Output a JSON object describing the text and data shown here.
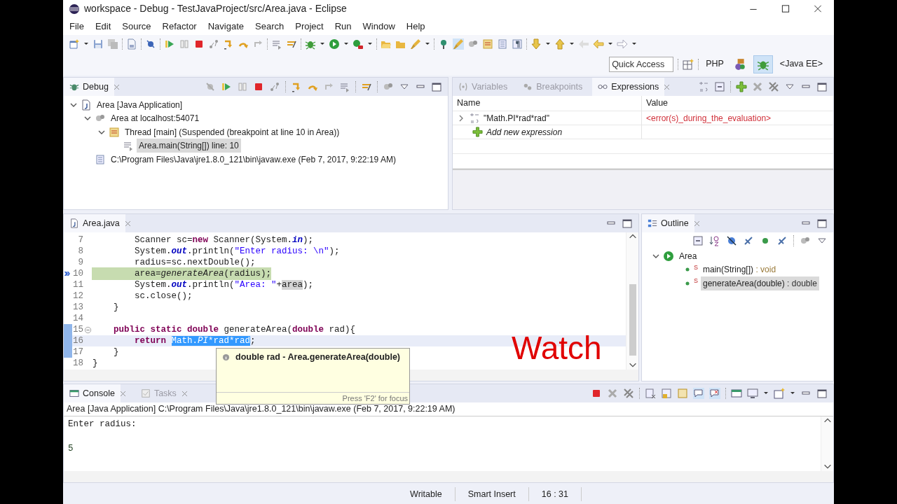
{
  "window": {
    "title": "workspace - Debug - TestJavaProject/src/Area.java - Eclipse"
  },
  "menu": [
    "File",
    "Edit",
    "Source",
    "Refactor",
    "Navigate",
    "Search",
    "Project",
    "Run",
    "Window",
    "Help"
  ],
  "quick_access": {
    "placeholder": "Quick Access"
  },
  "perspectives": [
    {
      "kind": "text",
      "label": "PHP",
      "selected": false
    },
    {
      "kind": "javaee",
      "selected": false
    },
    {
      "kind": "debug",
      "selected": true
    },
    {
      "kind": "text",
      "label": "<Java EE>",
      "selected": false
    }
  ],
  "debug_view": {
    "tab": "Debug",
    "tree": [
      {
        "kind": "launch",
        "label": "Area [Java Application]",
        "expanded": true,
        "selected": false,
        "children": [
          {
            "kind": "target",
            "label": "Area at localhost:54071",
            "expanded": true,
            "selected": false,
            "children": [
              {
                "kind": "thread",
                "label": "Thread [main] (Suspended (breakpoint at line 10 in Area))",
                "expanded": true,
                "selected": false,
                "children": [
                  {
                    "kind": "frame",
                    "label": "Area.main(String[]) line: 10",
                    "selected": true
                  }
                ]
              }
            ]
          },
          {
            "kind": "process",
            "label": "C:\\Program Files\\Java\\jre1.8.0_121\\bin\\javaw.exe (Feb 7, 2017, 9:22:19 AM)",
            "selected": false
          }
        ]
      }
    ]
  },
  "expressions_view": {
    "tabs": [
      {
        "label": "Variables",
        "selected": false
      },
      {
        "label": "Breakpoints",
        "selected": false
      },
      {
        "label": "Expressions",
        "selected": true
      }
    ],
    "columns": [
      "Name",
      "Value"
    ],
    "rows": [
      {
        "name": "\"Math.PI*rad*rad\"",
        "value": "<error(s)_during_the_evaluation>",
        "expanded": false,
        "error": true
      }
    ],
    "add_row": "Add new expression"
  },
  "editor": {
    "tab": "Area.java",
    "lines": [
      {
        "number": "7",
        "segments": [
          {
            "text": "        Scanner sc=",
            "kind": "plain"
          },
          {
            "text": "new",
            "kind": "keyword"
          },
          {
            "text": " Scanner(System.",
            "kind": "plain"
          },
          {
            "text": "in",
            "kind": "field"
          },
          {
            "text": ");",
            "kind": "plain"
          }
        ]
      },
      {
        "number": "8",
        "segments": [
          {
            "text": "        System.",
            "kind": "plain"
          },
          {
            "text": "out",
            "kind": "field"
          },
          {
            "text": ".println(",
            "kind": "plain"
          },
          {
            "text": "\"Enter radius: \\n\"",
            "kind": "string"
          },
          {
            "text": ");",
            "kind": "plain"
          }
        ]
      },
      {
        "number": "9",
        "segments": [
          {
            "text": "        radius=sc.nextDouble();",
            "kind": "plain"
          }
        ]
      },
      {
        "number": "10",
        "debug_current": true,
        "segments": [
          {
            "text": "        area=",
            "kind": "plain"
          },
          {
            "text": "generateArea",
            "kind": "static"
          },
          {
            "text": "(radius);",
            "kind": "plain"
          }
        ]
      },
      {
        "number": "11",
        "segments": [
          {
            "text": "        System.",
            "kind": "plain"
          },
          {
            "text": "out",
            "kind": "field"
          },
          {
            "text": ".println(",
            "kind": "plain"
          },
          {
            "text": "\"Area: \"",
            "kind": "string"
          },
          {
            "text": "+",
            "kind": "plain"
          },
          {
            "text": "area",
            "kind": "occurrence"
          },
          {
            "text": ");",
            "kind": "plain"
          }
        ]
      },
      {
        "number": "12",
        "segments": [
          {
            "text": "        sc.close();",
            "kind": "plain"
          }
        ]
      },
      {
        "number": "13",
        "segments": [
          {
            "text": "    }",
            "kind": "plain"
          }
        ]
      },
      {
        "number": "14"
      },
      {
        "number": "15",
        "ruler_mark": true,
        "foldable": true,
        "segments": [
          {
            "text": "    public static double",
            "kind": "keyword"
          },
          {
            "text": " generateArea(",
            "kind": "plain"
          },
          {
            "text": "double",
            "kind": "keyword"
          },
          {
            "text": " rad){",
            "kind": "plain"
          }
        ]
      },
      {
        "number": "16",
        "ruler_mark": true,
        "cursor_line": true,
        "segments": [
          {
            "text": "        return ",
            "kind": "keyword"
          },
          {
            "text": "Math.",
            "kind": "selected"
          },
          {
            "text": "PI",
            "kind": "selected-static"
          },
          {
            "text": "*rad*rad",
            "kind": "selected"
          },
          {
            "text": ";",
            "kind": "plain"
          }
        ]
      },
      {
        "number": "17",
        "ruler_mark": true,
        "segments": [
          {
            "text": "    }",
            "kind": "plain"
          }
        ]
      },
      {
        "number": "18",
        "segments": [
          {
            "text": "}",
            "kind": "plain"
          }
        ]
      }
    ]
  },
  "hover": {
    "text": "double rad - Area.generateArea(double)",
    "footer": "Press 'F2' for focus"
  },
  "caption": "Watch",
  "outline": {
    "tab": "Outline",
    "tree": [
      {
        "kind": "class",
        "label": "Area",
        "expanded": true,
        "selected": false,
        "children": [
          {
            "kind": "method",
            "static_mark": "S",
            "label": "main(String[])",
            "return_type": ": void",
            "selected": false
          },
          {
            "kind": "method",
            "static_mark": "S",
            "label": "generateArea(double)",
            "return_type": ": double",
            "selected": true
          }
        ]
      }
    ]
  },
  "console": {
    "tabs": [
      {
        "label": "Console",
        "selected": true
      },
      {
        "label": "Tasks",
        "selected": false
      }
    ],
    "header": "Area [Java Application] C:\\Program Files\\Java\\jre1.8.0_121\\bin\\javaw.exe (Feb 7, 2017, 9:22:19 AM)",
    "lines": [
      {
        "text": "Enter radius:",
        "kind": "output"
      },
      {
        "text": "5",
        "kind": "input"
      }
    ]
  },
  "status_bar": [
    "Writable",
    "Smart Insert",
    "16 : 31"
  ]
}
